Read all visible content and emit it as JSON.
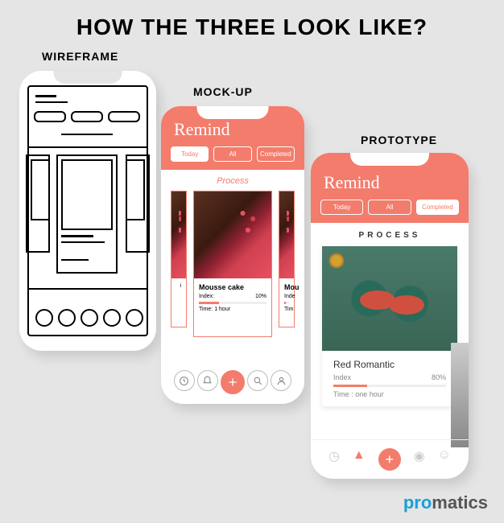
{
  "title": "HOW THE THREE LOOK LIKE?",
  "labels": {
    "wireframe": "WIREFRAME",
    "mockup": "MOCK-UP",
    "prototype": "PROTOTYPE"
  },
  "app": {
    "title": "Remind",
    "tabs": [
      "Today",
      "All",
      "Completed"
    ],
    "section_mockup": "Process",
    "section_proto": "PROCESS"
  },
  "mockup_card": {
    "title": "Mousse cake",
    "index_label": "Index:",
    "pct": "10%",
    "time_label": "Time:",
    "time_val": "1 hour",
    "partial": "Mou",
    "partial2": "Inde",
    "partial3": "Tim"
  },
  "proto_card": {
    "title": "Red Romantic",
    "index_label": "Index",
    "pct": "80%",
    "time_label": "Time :",
    "time_val": "one hour"
  },
  "logo": {
    "p1": "pro",
    "p2": "matics"
  }
}
